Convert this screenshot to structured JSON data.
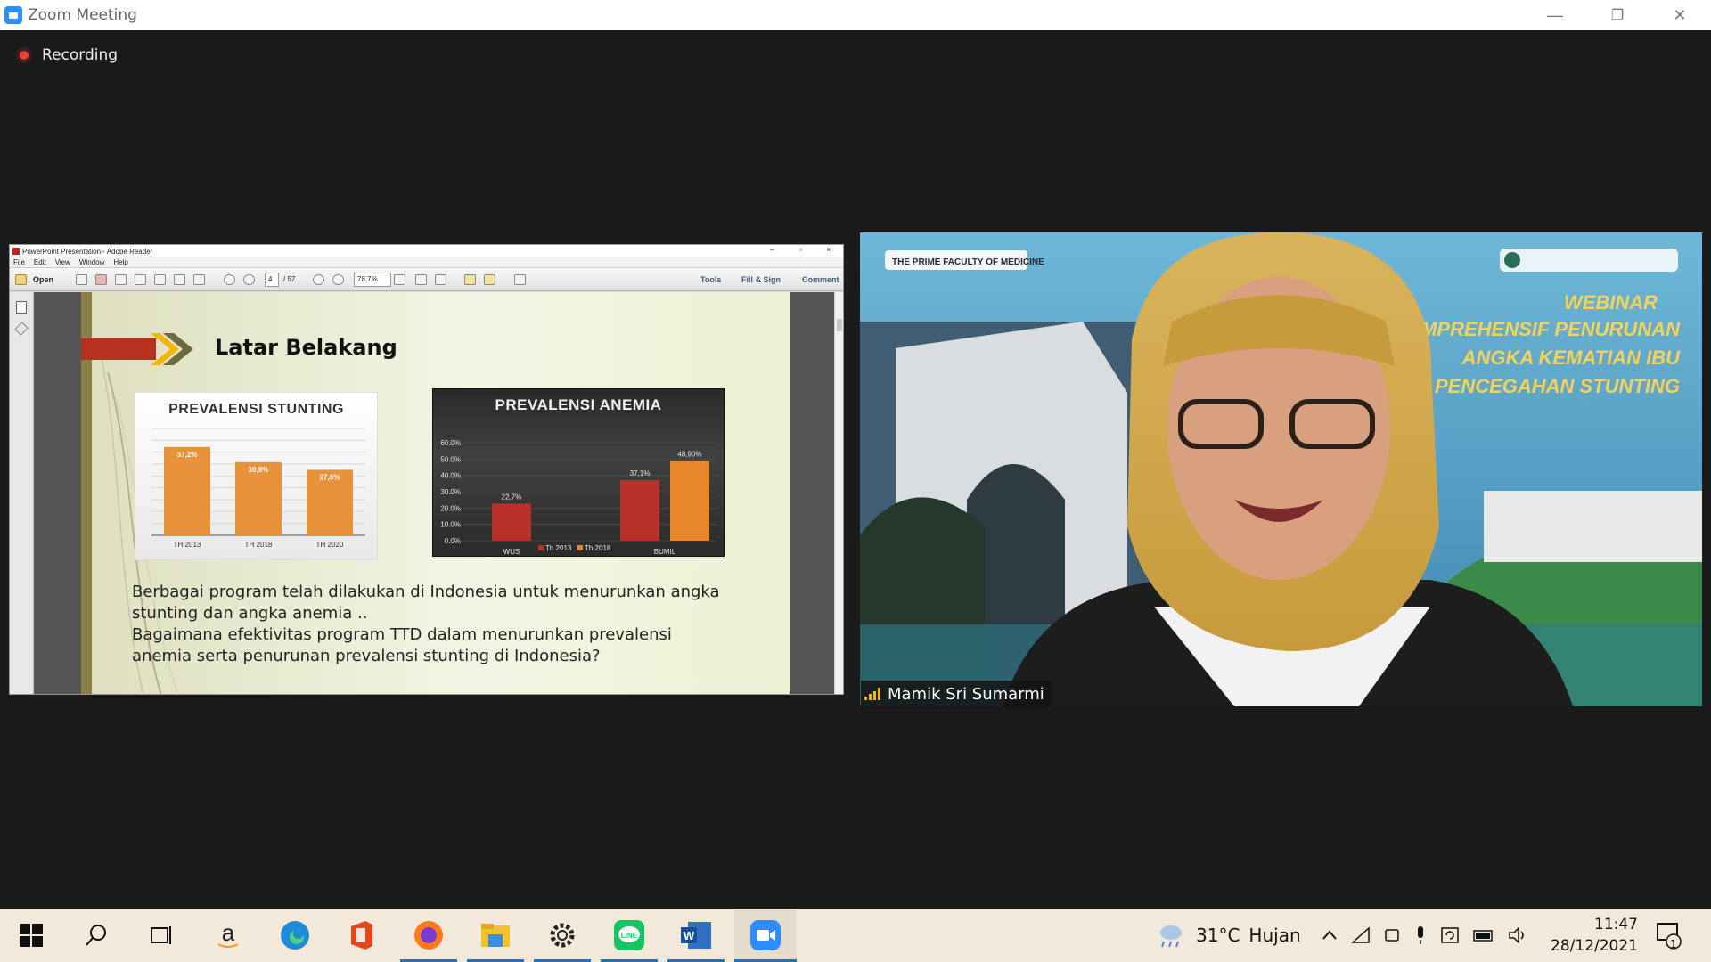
{
  "window": {
    "title": "Zoom Meeting",
    "minimize": "—",
    "restore": "❐",
    "close": "✕"
  },
  "recording": {
    "label": "Recording"
  },
  "reader": {
    "title": "PowerPoint Presentation - Adobe Reader",
    "controls": {
      "min": "–",
      "max": "▫",
      "close": "×"
    },
    "menu": [
      "File",
      "Edit",
      "View",
      "Window",
      "Help"
    ],
    "toolbar": {
      "open": "Open",
      "page": "4",
      "of": "/ 57",
      "zoom": "78,7%",
      "tools": "Tools",
      "fill_sign": "Fill & Sign",
      "comment": "Comment"
    }
  },
  "slide": {
    "heading": "Latar Belakang",
    "paragraph_lines": [
      "Berbagai program telah dilakukan di Indonesia untuk menurunkan angka",
      "stunting dan angka anemia ..",
      "Bagaimana efektivitas program TTD dalam menurunkan prevalensi",
      "anemia serta penurunan prevalensi stunting di Indonesia?"
    ]
  },
  "chart_data": [
    {
      "type": "bar",
      "title": "PREVALENSI STUNTING",
      "categories": [
        "TH 2013",
        "TH 2018",
        "TH 2020"
      ],
      "values": [
        37.2,
        30.8,
        27.6
      ],
      "data_labels": [
        "37,2%",
        "30,8%",
        "27,6%"
      ],
      "ylim": [
        0,
        45
      ],
      "grid": true,
      "color": "#e8923a"
    },
    {
      "type": "bar",
      "title": "PREVALENSI ANEMIA",
      "categories": [
        "WUS",
        "BUMIL"
      ],
      "series": [
        {
          "name": "Th 2013",
          "values": [
            22.7,
            37.1
          ],
          "color": "#b7312a"
        },
        {
          "name": "Th 2018",
          "values": [
            null,
            48.9
          ],
          "color": "#e8862a"
        }
      ],
      "data_labels": [
        "22,7%",
        "37,1%",
        "48,90%"
      ],
      "yticks": [
        "0.0%",
        "10.0%",
        "20.0%",
        "30.0%",
        "40.0%",
        "50.0%",
        "60.0%"
      ],
      "ylim": [
        0,
        60
      ],
      "legend": "bottom"
    }
  ],
  "video": {
    "participant": "Mamik Sri Sumarmi",
    "banner_left": "THE PRIME FACULTY OF MEDICINE",
    "banner_lines": [
      "WEBINAR",
      "N KOMPREHENSIF PENURUNAN",
      "ANGKA KEMATIAN IBU",
      "DAN PENCEGAHAN STUNTING"
    ]
  },
  "taskbar": {
    "apps": [
      "start-icon",
      "search-icon",
      "task-view-icon",
      "amazon-icon",
      "edge-icon",
      "office-icon",
      "firefox-icon",
      "file-explorer-icon",
      "settings-icon",
      "line-icon",
      "word-icon",
      "zoom-icon"
    ],
    "weather": {
      "temp": "31°C",
      "condition": "Hujan"
    },
    "time": "11:47",
    "date": "28/12/2021",
    "notifications": "1"
  },
  "colors": {
    "zoom_blue": "#2d8cff",
    "recording_red": "#e8412c",
    "taskbar_bg": "#f3e9da"
  }
}
